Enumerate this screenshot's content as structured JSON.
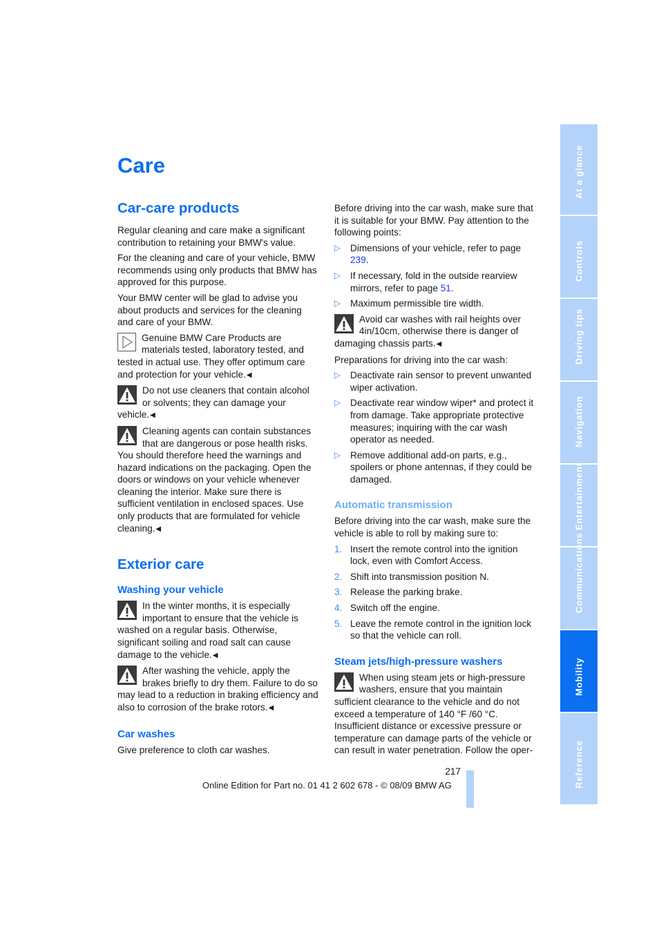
{
  "page": {
    "title": "Care",
    "number": "217",
    "footer": "Online Edition for Part no. 01 41 2 602 678 - © 08/09 BMW AG"
  },
  "colors": {
    "accent": "#0a6ff0",
    "sidebar_inactive": "#b3d3fb",
    "link": "#1a3cf0"
  },
  "sidebar": {
    "tabs": [
      {
        "label": "At a glance",
        "active": false
      },
      {
        "label": "Controls",
        "active": false
      },
      {
        "label": "Driving tips",
        "active": false
      },
      {
        "label": "Navigation",
        "active": false
      },
      {
        "label": "Entertainment",
        "active": false
      },
      {
        "label": "Communications",
        "active": false
      },
      {
        "label": "Mobility",
        "active": true
      },
      {
        "label": "Reference",
        "active": false
      }
    ]
  },
  "left": {
    "car_care": {
      "heading": "Car-care products",
      "p1": "Regular cleaning and care make a significant contribution to retaining your BMW's value.",
      "p2": "For the cleaning and care of your vehicle, BMW recommends using only products that BMW has approved for this purpose.",
      "p3": "Your BMW center will be glad to advise you about products and services for the cleaning and care of your BMW.",
      "tip": {
        "icon": "tip-triangle-icon",
        "text": "Genuine BMW Care Products are materials tested, laboratory tested, and tested in actual use. They offer optimum care and protection for your vehicle."
      },
      "warn1": {
        "icon": "warning-icon",
        "text": "Do not use cleaners that contain alcohol or solvents; they can damage your vehicle."
      },
      "warn2": {
        "icon": "warning-icon",
        "text": "Cleaning agents can contain substances that are dangerous or pose health risks. You should therefore heed the warnings and hazard indications on the packaging. Open the doors or windows on your vehicle whenever cleaning the interior. Make sure there is sufficient ventilation in enclosed spaces. Use only products that are formulated for vehicle cleaning."
      }
    },
    "exterior": {
      "heading": "Exterior care",
      "washing": {
        "heading": "Washing your vehicle",
        "warn1": "In the winter months, it is especially important to ensure that the vehicle is washed on a regular basis. Otherwise, significant soiling and road salt can cause damage to the vehicle.",
        "warn2": "After washing the vehicle, apply the brakes briefly to dry them. Failure to do so may lead to a reduction in braking efficiency and also to corrosion of the brake rotors."
      },
      "car_washes": {
        "heading": "Car washes",
        "p1": "Give preference to cloth car washes."
      }
    }
  },
  "right": {
    "intro": "Before driving into the car wash, make sure that it is suitable for your BMW. Pay attention to the following points:",
    "points": [
      {
        "text": "Dimensions of your vehicle, refer to page ",
        "link": "239",
        "after": "."
      },
      {
        "text": "If necessary, fold in the outside rearview mirrors, refer to page ",
        "link": "51",
        "after": "."
      },
      {
        "text": "Maximum permissible tire width.",
        "link": null,
        "after": ""
      }
    ],
    "warn_rail": "Avoid car washes with rail heights over 4in/10cm, otherwise there is danger of damaging chassis parts.",
    "prep_intro": "Preparations for driving into the car wash:",
    "prep": [
      "Deactivate rain sensor to prevent unwanted wiper activation.",
      "Deactivate rear window wiper* and protect it from damage. Take appropriate protective measures; inquiring with the car wash operator as needed.",
      "Remove additional add-on parts, e.g., spoilers or phone antennas, if they could be damaged."
    ],
    "auto_trans": {
      "heading": "Automatic transmission",
      "intro": "Before driving into the car wash, make sure the vehicle is able to roll by making sure to:",
      "steps": [
        "Insert the remote control into the ignition lock, even with Comfort Access.",
        "Shift into transmission position N.",
        "Release the parking brake.",
        "Switch off the engine.",
        "Leave the remote control in the ignition lock so that the vehicle can roll."
      ]
    },
    "steam": {
      "heading": "Steam jets/high-pressure washers",
      "warn": "When using steam jets or high-pressure washers, ensure that you maintain sufficient clearance to the vehicle and do not exceed a temperature of 140 °F /60 °C.",
      "p1": "Insufficient distance or excessive pressure or temperature can damage parts of the vehicle or can result in water penetration. Follow the oper-"
    }
  }
}
